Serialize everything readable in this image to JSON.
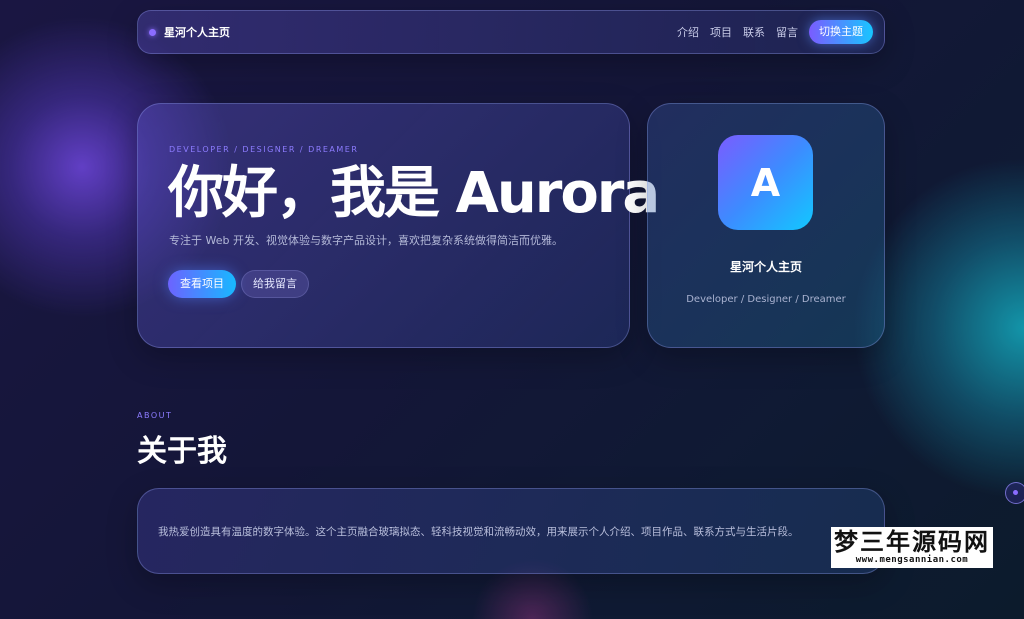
{
  "nav": {
    "brand": "星河个人主页",
    "links": [
      "介绍",
      "项目",
      "联系",
      "留言"
    ],
    "theme_button": "切换主题"
  },
  "hero": {
    "eyebrow": "DEVELOPER / DESIGNER / DREAMER",
    "headline": "你好，我是 Aurora",
    "subtitle": "专注于 Web 开发、视觉体验与数字产品设计，喜欢把复杂系统做得简洁而优雅。",
    "primary_button": "查看项目",
    "secondary_button": "给我留言"
  },
  "profile": {
    "avatar_letter": "A",
    "name": "星河个人主页",
    "role": "Developer / Designer / Dreamer"
  },
  "about": {
    "eyebrow": "ABOUT",
    "title": "关于我",
    "text": "我热爱创造具有温度的数字体验。这个主页融合玻璃拟态、轻科技视觉和流畅动效，用来展示个人介绍、项目作品、联系方式与生活片段。"
  },
  "watermark": {
    "title": "梦三年源码网",
    "url": "www.mengsannian.com"
  },
  "colors": {
    "accent_purple": "#7a5cff",
    "accent_cyan": "#18c6ff",
    "background": "#141638"
  }
}
